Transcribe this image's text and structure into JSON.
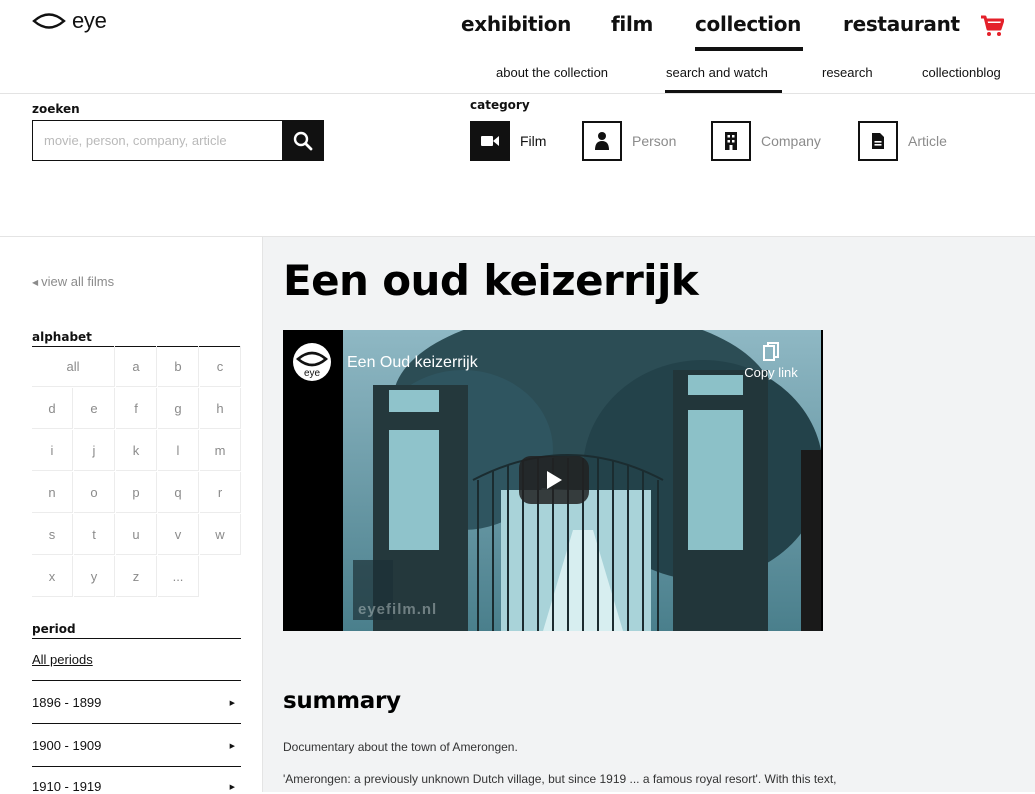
{
  "header": {
    "logo_text": "eye",
    "main_nav": [
      "exhibition",
      "film",
      "collection",
      "restaurant"
    ],
    "main_nav_active": "collection",
    "sub_nav": [
      "about the collection",
      "search and watch",
      "research",
      "collectionblog"
    ],
    "sub_nav_active": "search and watch",
    "cart_color": "#e4202a"
  },
  "search": {
    "label": "zoeken",
    "placeholder": "movie, person, company, article",
    "value": ""
  },
  "category": {
    "label": "category",
    "items": [
      {
        "label": "Film",
        "icon": "video-camera-icon",
        "active": true
      },
      {
        "label": "Person",
        "icon": "person-icon",
        "active": false
      },
      {
        "label": "Company",
        "icon": "building-icon",
        "active": false
      },
      {
        "label": "Article",
        "icon": "document-icon",
        "active": false
      }
    ]
  },
  "sidebar": {
    "back_link": "view all films",
    "alphabet_label": "alphabet",
    "alphabet": [
      "all",
      "a",
      "b",
      "c",
      "d",
      "e",
      "f",
      "g",
      "h",
      "i",
      "j",
      "k",
      "l",
      "m",
      "n",
      "o",
      "p",
      "q",
      "r",
      "s",
      "t",
      "u",
      "v",
      "w",
      "x",
      "y",
      "z",
      "..."
    ],
    "period_label": "period",
    "all_periods": "All periods",
    "periods": [
      "1896 - 1899",
      "1900 - 1909",
      "1910 - 1919"
    ]
  },
  "main": {
    "title": "Een oud keizerrijk",
    "video": {
      "title": "Een Oud keizerrijk",
      "channel_logo_text": "eye",
      "copy_link": "Copy link",
      "watermark": "eyefilm.nl"
    },
    "summary_heading": "summary",
    "summary_lines": [
      "Documentary about the town of Amerongen.",
      "'Amerongen: a previously unknown Dutch village, but since 1919 ... a famous royal resort'. With this text,"
    ]
  }
}
